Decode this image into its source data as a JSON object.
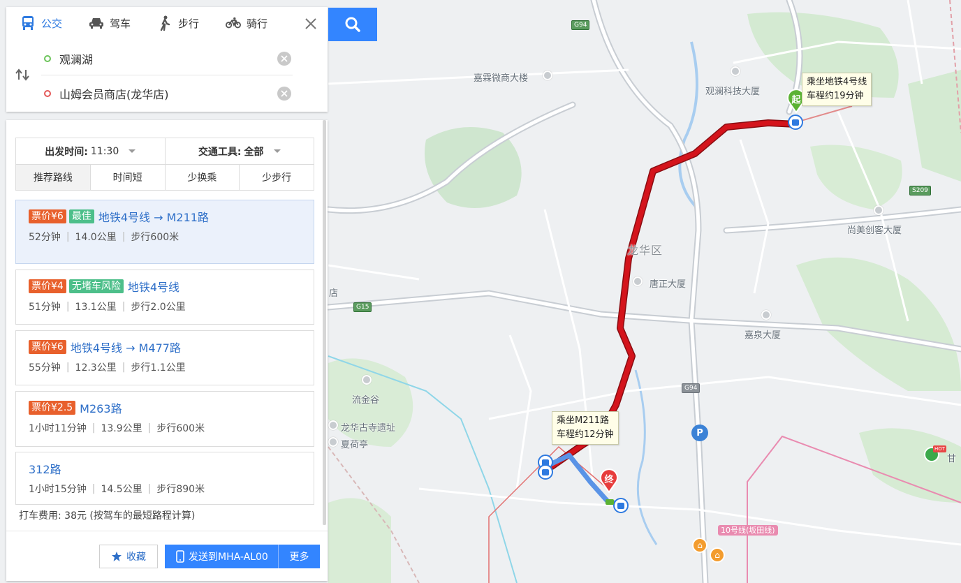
{
  "mode_tabs": [
    {
      "label": "公交",
      "icon": "bus-icon",
      "active": true
    },
    {
      "label": "驾车",
      "icon": "car-icon",
      "active": false
    },
    {
      "label": "步行",
      "icon": "walk-icon",
      "active": false
    },
    {
      "label": "骑行",
      "icon": "bike-icon",
      "active": false
    }
  ],
  "route": {
    "from": "观澜湖",
    "to": "山姆会员商店(龙华店)"
  },
  "filters": {
    "depart_label": "出发时间:",
    "depart_value": "11:30",
    "tool_label": "交通工具:",
    "tool_value": "全部",
    "sort_tabs": [
      "推荐路线",
      "时间短",
      "少换乘",
      "少步行"
    ]
  },
  "routes": [
    {
      "price": "票价¥6",
      "badge": "最佳",
      "title": "地铁4号线 → M211路",
      "time": "52分钟",
      "distance": "14.0公里",
      "walk": "步行600米"
    },
    {
      "price": "票价¥4",
      "badge": "无堵车风险",
      "title": "地铁4号线",
      "time": "51分钟",
      "distance": "13.1公里",
      "walk": "步行2.0公里"
    },
    {
      "price": "票价¥6",
      "title": "地铁4号线 → M477路",
      "time": "55分钟",
      "distance": "12.3公里",
      "walk": "步行1.1公里"
    },
    {
      "price": "票价¥2.5",
      "title": "M263路",
      "time": "1小时11分钟",
      "distance": "13.9公里",
      "walk": "步行600米"
    },
    {
      "title": "312路",
      "time": "1小时15分钟",
      "distance": "14.5公里",
      "walk": "步行890米"
    }
  ],
  "taxi": "打车费用: 38元 (按驾车的最短路程计算)",
  "actions": {
    "favorite": "收藏",
    "send": "发送到MHA-AL00",
    "more": "更多"
  },
  "map": {
    "labels": {
      "jiamei": "嘉霖微商大楼",
      "guanlan_tech": "观澜科技大厦",
      "shangmei": "尚美创客大厦",
      "longhua_district": "龙华区",
      "tangzheng": "唐正大厦",
      "jiaquan": "嘉泉大厦",
      "liujin": "流金谷",
      "longhua_temple": "龙华古寺遗址",
      "xiahe": "夏荷亭",
      "shop_partial": "店",
      "gan_partial": "甘"
    },
    "road_badges": {
      "g94_top": "G94",
      "g15": "G15",
      "g94_mid": "G94",
      "s209": "S209"
    },
    "metro_label": "10号线(坂田线)",
    "start_bubble": {
      "line1": "乘坐地铁4号线",
      "line2": "车程约19分钟"
    },
    "transfer_bubble": {
      "line1": "乘坐M211路",
      "line2": "车程约12分钟"
    },
    "start_pin": "起",
    "end_pin": "终",
    "parking": "P",
    "hot_badge": "HOT",
    "route_colors": {
      "metro": "#d4141c",
      "bus": "#5a93e6",
      "walk": "#e06b6b"
    }
  }
}
